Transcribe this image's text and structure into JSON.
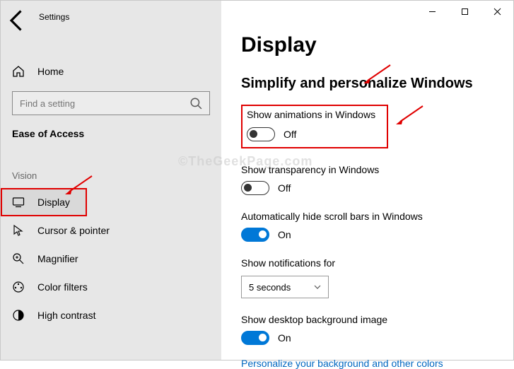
{
  "app": {
    "title": "Settings"
  },
  "sidebar": {
    "home": "Home",
    "search_placeholder": "Find a setting",
    "section": "Ease of Access",
    "group1": "Vision",
    "items": [
      {
        "label": "Display"
      },
      {
        "label": "Cursor & pointer"
      },
      {
        "label": "Magnifier"
      },
      {
        "label": "Color filters"
      },
      {
        "label": "High contrast"
      }
    ]
  },
  "page": {
    "title": "Display",
    "section": "Simplify and personalize Windows",
    "anim": {
      "label": "Show animations in Windows",
      "state": "Off"
    },
    "trans": {
      "label": "Show transparency in Windows",
      "state": "Off"
    },
    "scroll": {
      "label": "Automatically hide scroll bars in Windows",
      "state": "On"
    },
    "notif": {
      "label": "Show notifications for",
      "value": "5 seconds"
    },
    "bg": {
      "label": "Show desktop background image",
      "state": "On"
    },
    "link": "Personalize your background and other colors"
  },
  "watermark": "©TheGeekPage.com"
}
